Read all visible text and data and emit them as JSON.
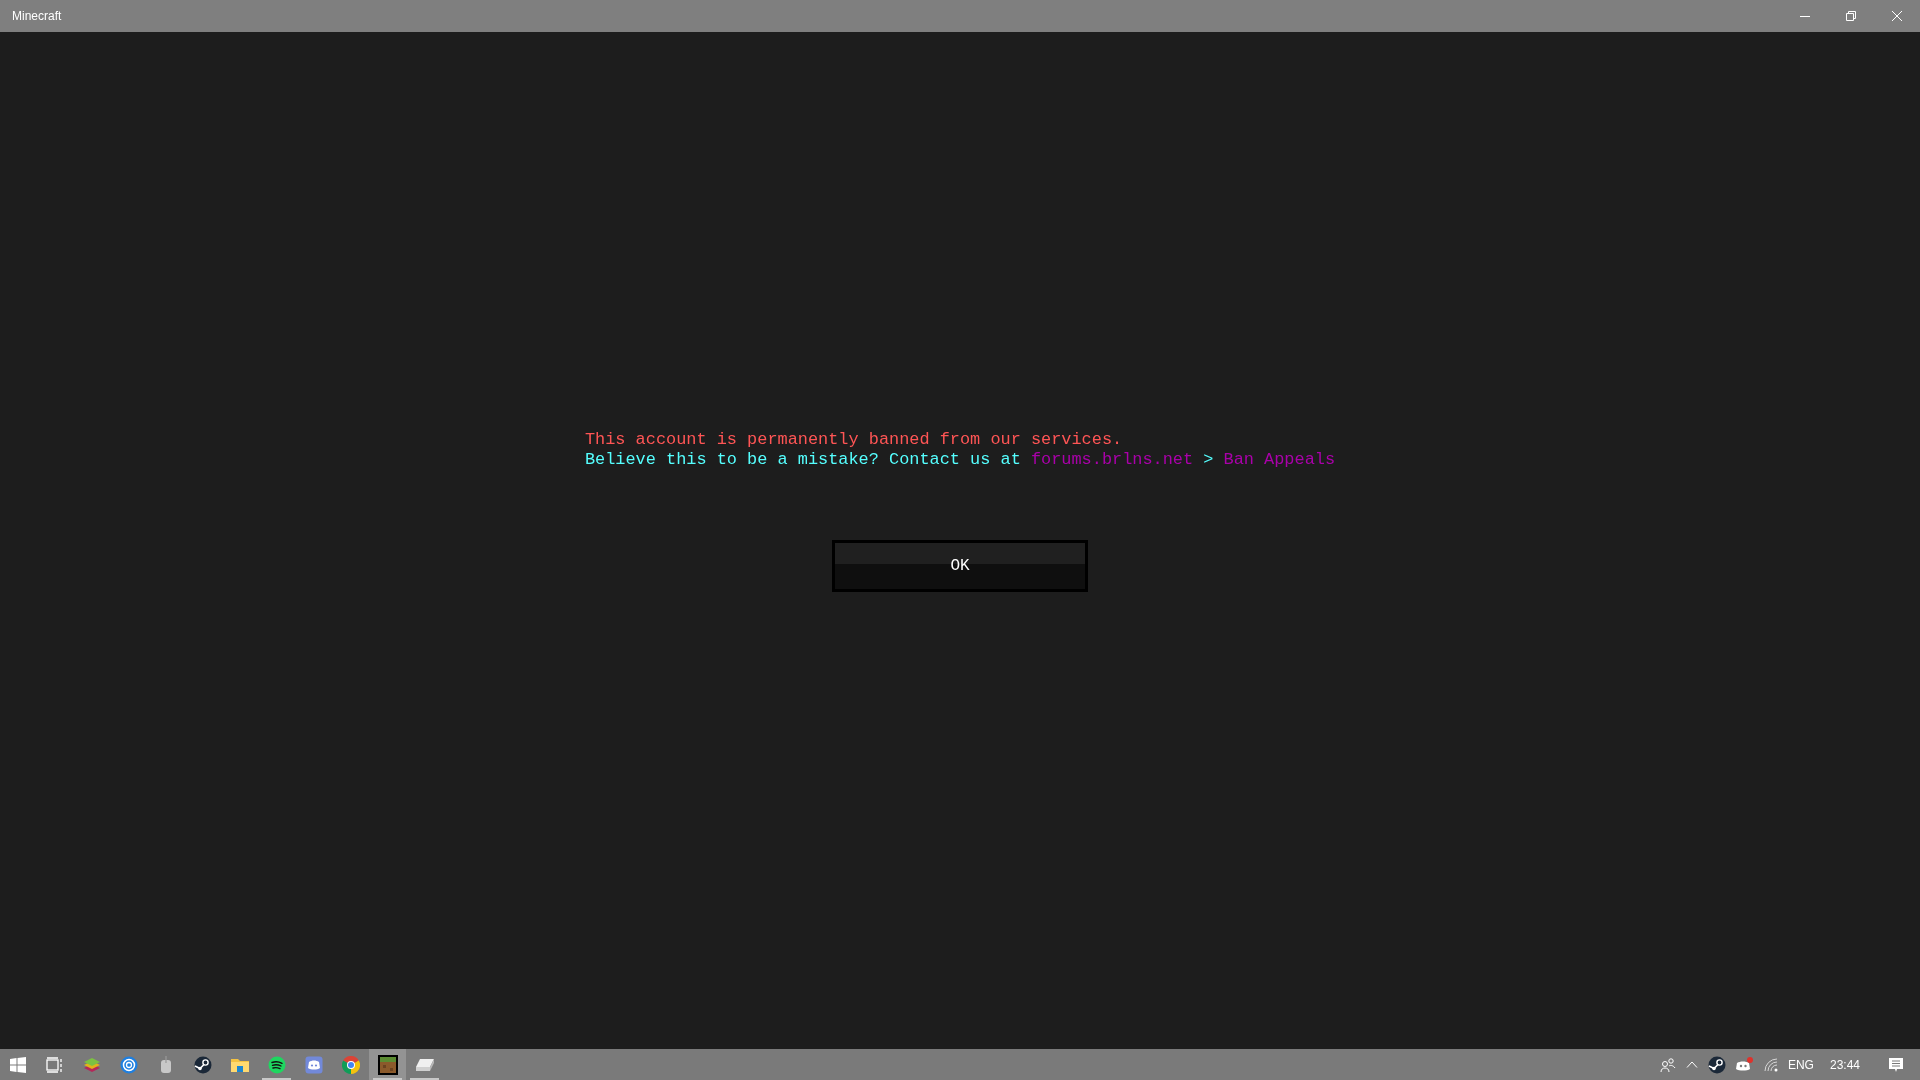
{
  "window": {
    "title": "Minecraft"
  },
  "message": {
    "lines": [
      {
        "segments": [
          {
            "text": "This account is permanently banned from our services.",
            "color": "#ff5555"
          }
        ]
      },
      {
        "segments": [
          {
            "text": "Believe this to be a mistake? Contact us at ",
            "color": "#55ffff"
          },
          {
            "text": "forums.brlns.net",
            "color": "#aa00aa"
          },
          {
            "text": " > ",
            "color": "#55ffff"
          },
          {
            "text": "Ban Appeals",
            "color": "#aa00aa"
          }
        ]
      }
    ]
  },
  "button": {
    "label": "OK"
  },
  "taskbar": {
    "apps": [
      {
        "kind": "start",
        "open": false,
        "selected": false
      },
      {
        "kind": "taskview",
        "open": false,
        "selected": false
      },
      {
        "kind": "layers",
        "open": false,
        "selected": false
      },
      {
        "kind": "bluecircle",
        "open": false,
        "selected": false
      },
      {
        "kind": "mouse",
        "open": false,
        "selected": false
      },
      {
        "kind": "steam",
        "open": false,
        "selected": false
      },
      {
        "kind": "folder",
        "open": false,
        "selected": false
      },
      {
        "kind": "spotify",
        "open": true,
        "selected": false
      },
      {
        "kind": "discord",
        "open": false,
        "selected": false
      },
      {
        "kind": "chrome",
        "open": false,
        "selected": false
      },
      {
        "kind": "grassblock",
        "open": true,
        "selected": true
      },
      {
        "kind": "device",
        "open": true,
        "selected": false
      }
    ],
    "tray": {
      "language": "ENG",
      "time": "23:44"
    }
  }
}
